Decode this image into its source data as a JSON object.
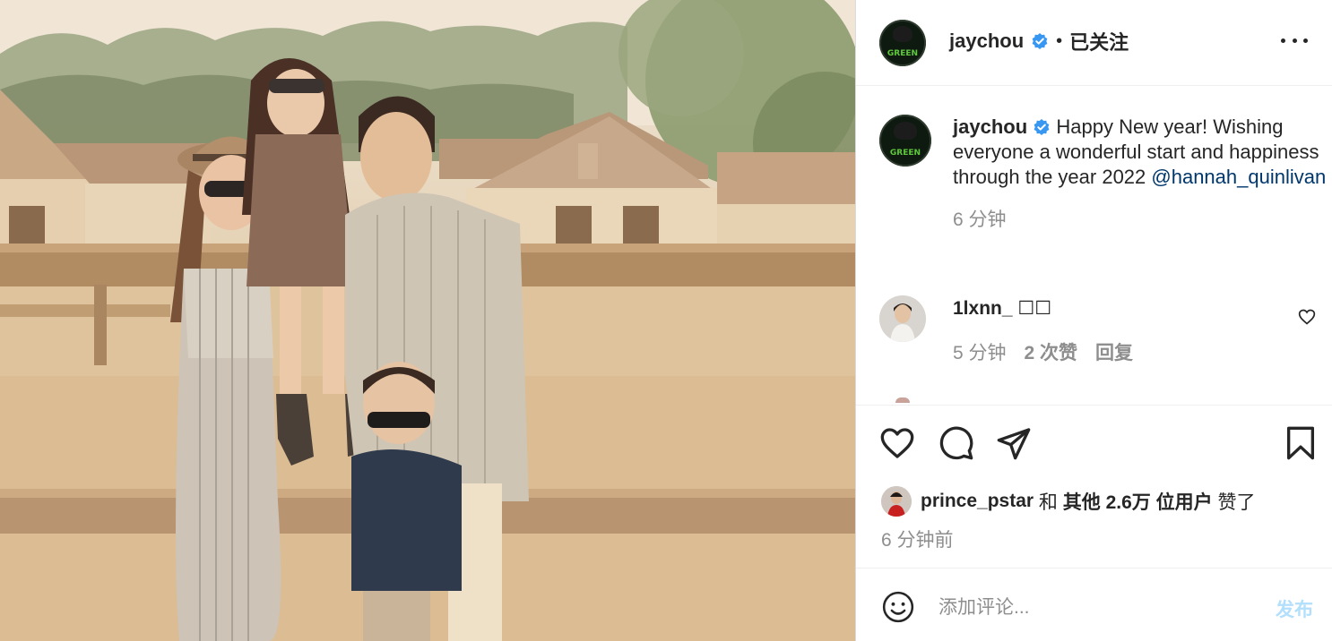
{
  "colors": {
    "accent_blue": "#0095f6",
    "post_button_disabled": "#b2dffc",
    "mention_link": "#00376b",
    "secondary_text": "#8e8e8e",
    "primary_text": "#262626"
  },
  "post": {
    "image_alt": "Family photo of four people standing in front of a wooden fence at a horse ranch",
    "author": {
      "username": "jaychou",
      "verified": true,
      "follow_status": "已关注",
      "avatar_letters": "GREEN"
    },
    "caption": {
      "username": "jaychou",
      "text": "Happy New year! Wishing everyone a wonderful start and happiness through the year 2022 ",
      "mention": "@hannah_quinlivan",
      "time": "6 分钟"
    },
    "comments": [
      {
        "username": "1lxnn_ ☐☐",
        "time": "5 分钟",
        "likes": "2 次赞",
        "reply_label": "回复"
      }
    ],
    "likes": {
      "first_liker": "prince_pstar",
      "connector": " 和 ",
      "others": "其他 2.6万 位用户",
      "suffix": " 赞了"
    },
    "time_ago": "6 分钟前",
    "comment_box": {
      "placeholder": "添加评论...",
      "post_label": "发布"
    },
    "icons": {
      "more": "more-options-icon",
      "like": "heart-icon",
      "comment": "comment-bubble-icon",
      "share": "paper-plane-icon",
      "save": "bookmark-icon",
      "emoji": "smiley-icon",
      "verified": "verified-badge-icon"
    }
  }
}
